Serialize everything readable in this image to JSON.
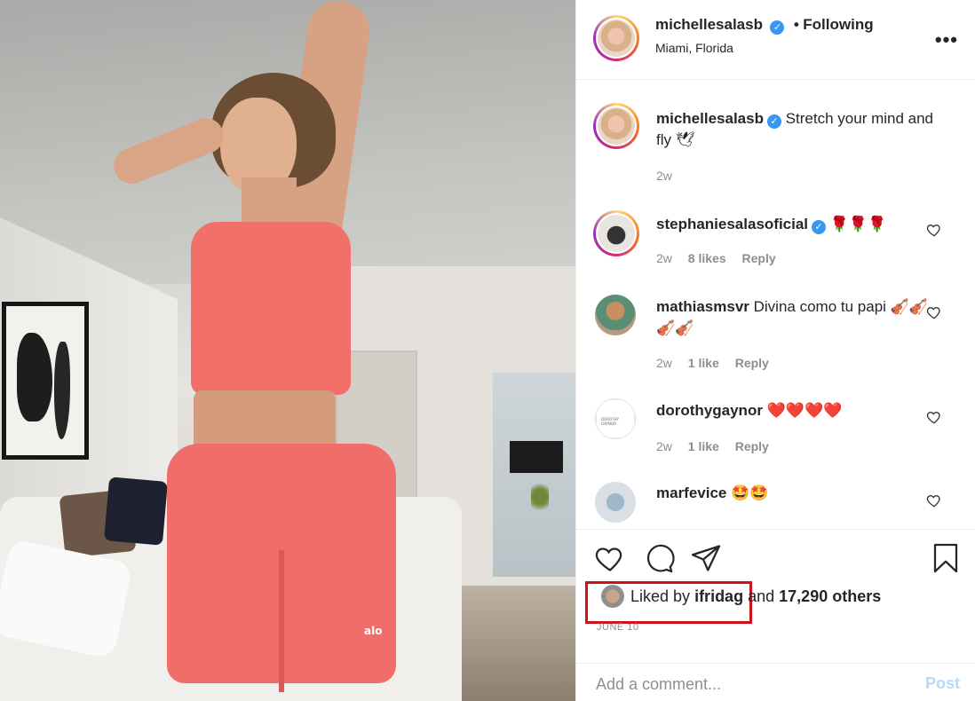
{
  "post": {
    "username": "michellesalasb",
    "follow_status": "Following",
    "separator": "•",
    "location": "Miami, Florida",
    "more_label": "•••",
    "photo_logo": "alo"
  },
  "caption": {
    "username": "michellesalasb",
    "text": "Stretch your mind and fly 🕊",
    "time": "2w"
  },
  "comments": [
    {
      "username": "stephaniesalasoficial",
      "verified": true,
      "text": "🌹🌹🌹",
      "time": "2w",
      "likes": "8 likes",
      "reply": "Reply"
    },
    {
      "username": "mathiasmsvr",
      "verified": false,
      "text": "Divina como tu papi 🎻🎻🎻🎻",
      "time": "2w",
      "likes": "1 like",
      "reply": "Reply"
    },
    {
      "username": "dorothygaynor",
      "verified": false,
      "text": "❤️❤️❤️❤️",
      "time": "2w",
      "likes": "1 like",
      "reply": "Reply",
      "avatar_text": "DOROTHY GAYNOR"
    },
    {
      "username": "marfevice",
      "verified": false,
      "text": "🤩🤩",
      "time": "",
      "likes": "",
      "reply": ""
    }
  ],
  "likes": {
    "prefix": "Liked by",
    "user": "ifridag",
    "middle": "and",
    "others": "17,290 others"
  },
  "date": "JUNE 10",
  "add_comment": {
    "placeholder": "Add a comment...",
    "post_label": "Post"
  },
  "colors": {
    "verified": "#3897f0",
    "highlight": "#d0111b",
    "post_button": "#b3dbff"
  }
}
